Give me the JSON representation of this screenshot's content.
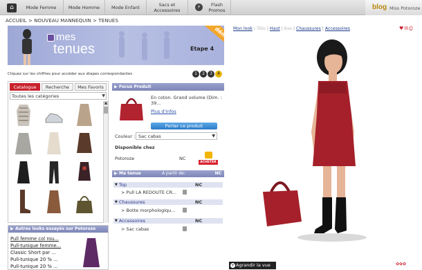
{
  "nav": {
    "items": [
      "Mode Femme",
      "Mode Homme",
      "Mode Enfant"
    ],
    "sacs": "Sacs et",
    "accessoires": "Accessoires",
    "flash": "Flash",
    "promos": "Promos",
    "blog": "blog",
    "user": "Miss Potoroze"
  },
  "breadcrumb": "ACCUEIL > NOUVEAU MANNEQUIN > TENUES",
  "banner": {
    "mes": "mes",
    "tenues": "tenues",
    "step": "Etape 4",
    "demo": "démo"
  },
  "hint": "Cliquez sur les chiffres pour accéder aux étapes correspondantes",
  "steps": [
    "1",
    "2",
    "3",
    "4"
  ],
  "catalogue": {
    "tabs": [
      "Catalogue",
      "Recherche",
      "Mes Favoris"
    ],
    "category": "Toutes les catégories"
  },
  "looks": {
    "title": "Autres looks essayés sur Potoroze",
    "items": [
      "Pull femme col rou...",
      "Pull-tunique femme...",
      "Classic Short par ...",
      "Pull-tunique 20 % ...",
      "Pull-tunique 20 % ..."
    ]
  },
  "focus": {
    "title": "Focus Produit",
    "desc": "En coton. Grand volume (Dim. : 39...",
    "more": "Plus d'infos",
    "porter": "Porter ce produit",
    "color_label": "Couleur :",
    "color_value": "Sac cabas",
    "dispo": "Disponible chez",
    "shop": "Potoroze",
    "price": "NC",
    "acheter": "ACHETER"
  },
  "tenue": {
    "title": "Ma tenue",
    "from": "A partir de:",
    "nc": "NC",
    "cats": [
      {
        "name": "Top",
        "nc": "NC",
        "item": "> Pull LA REDOUTE CR..."
      },
      {
        "name": "Chaussures",
        "nc": "NC",
        "item": "> Botte morphologiqu..."
      },
      {
        "name": "Accessoires",
        "nc": "NC",
        "item": "> Sac cabas"
      }
    ]
  },
  "look_links": {
    "label": "Mon look",
    "items": [
      "Tête",
      "Haut",
      "Bas",
      "Chaussures",
      "Accessoires"
    ],
    "enabled": [
      false,
      true,
      false,
      true,
      true
    ]
  },
  "agrandir": "Agrandir la vue",
  "colors": {
    "tab_active": "#c9232e",
    "panel_header": "#8890c2",
    "banner": "#b7bfe3",
    "dress": "#a5202a",
    "button": "#2c7bc7"
  }
}
